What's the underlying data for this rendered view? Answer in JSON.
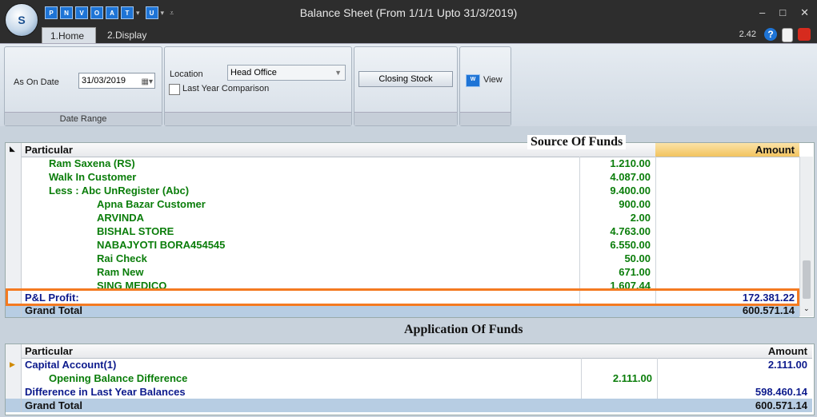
{
  "window": {
    "title": "Balance Sheet (From 1/1/1 Upto 31/3/2019)",
    "logo_text": "S",
    "quick_access": [
      "P",
      "N",
      "V",
      "O",
      "A",
      "T",
      "U"
    ],
    "controls": [
      "–",
      "□",
      "✕"
    ],
    "version": "2.42"
  },
  "tabs": [
    "1.Home",
    "2.Display"
  ],
  "ribbon": {
    "date_range": {
      "as_on_label": "As On Date",
      "date_value": "31/03/2019",
      "group_label": "Date Range"
    },
    "location": {
      "label": "Location",
      "value": "Head Office",
      "checkbox_label": "Last Year Comparison"
    },
    "closing_stock_label": "Closing Stock",
    "view_label": "View",
    "view_icon_text": "W"
  },
  "source": {
    "title": "Source Of Funds",
    "columns": {
      "particular": "Particular",
      "amount": "Amount"
    },
    "rows": [
      {
        "name": "Ram Saxena (RS)",
        "sub": "1.210.00",
        "amount": "",
        "indent": 1,
        "color": "green"
      },
      {
        "name": "Walk In Customer",
        "sub": "4.087.00",
        "amount": "",
        "indent": 1,
        "color": "green"
      },
      {
        "name": "Less : Abc UnRegister (Abc)",
        "sub": "9.400.00",
        "amount": "",
        "indent": 1,
        "color": "green"
      },
      {
        "name": "Apna Bazar Customer",
        "sub": "900.00",
        "amount": "",
        "indent": 2,
        "color": "green"
      },
      {
        "name": "ARVINDA",
        "sub": "2.00",
        "amount": "",
        "indent": 2,
        "color": "green"
      },
      {
        "name": "BISHAL STORE",
        "sub": "4.763.00",
        "amount": "",
        "indent": 2,
        "color": "green"
      },
      {
        "name": "NABAJYOTI BORA454545",
        "sub": "6.550.00",
        "amount": "",
        "indent": 2,
        "color": "green"
      },
      {
        "name": "Rai Check",
        "sub": "50.00",
        "amount": "",
        "indent": 2,
        "color": "green"
      },
      {
        "name": "Ram New",
        "sub": "671.00",
        "amount": "",
        "indent": 2,
        "color": "green"
      },
      {
        "name": "SING MEDICO",
        "sub": "1.607.44",
        "amount": "",
        "indent": 2,
        "color": "green"
      },
      {
        "name": "P&L Profit:",
        "sub": "",
        "amount": "172.381.22",
        "indent": 0,
        "color": "blue"
      }
    ],
    "grand_total": {
      "label": "Grand Total",
      "amount": "600.571.14"
    }
  },
  "application": {
    "title": "Application Of Funds",
    "columns": {
      "particular": "Particular",
      "amount": "Amount"
    },
    "rows": [
      {
        "name": "Capital Account(1)",
        "sub": "",
        "amount": "2.111.00",
        "indent": 0,
        "color": "blue"
      },
      {
        "name": "Opening Balance Difference",
        "sub": "2.111.00",
        "amount": "",
        "indent": 1,
        "color": "green"
      },
      {
        "name": "Difference in Last Year Balances",
        "sub": "",
        "amount": "598.460.14",
        "indent": 0,
        "color": "blue"
      }
    ],
    "grand_total": {
      "label": "Grand Total",
      "amount": "600.571.14"
    }
  }
}
